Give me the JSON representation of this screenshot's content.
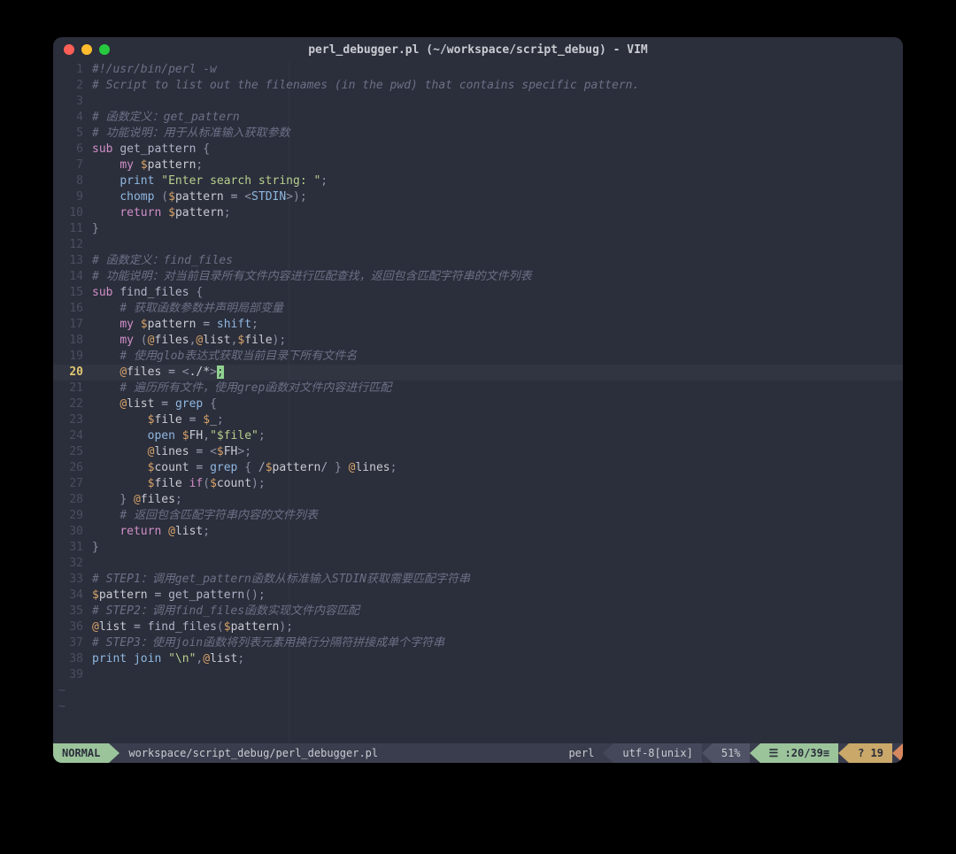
{
  "window": {
    "title": "perl_debugger.pl (~/workspace/script_debug) - VIM"
  },
  "editor": {
    "current_line": 20,
    "lines": [
      {
        "n": 1,
        "tokens": [
          [
            "c-comment",
            "#!/usr/bin/perl -w"
          ]
        ]
      },
      {
        "n": 2,
        "tokens": [
          [
            "c-comment",
            "# Script to list out the filenames (in the pwd) that contains specific pattern."
          ]
        ]
      },
      {
        "n": 3,
        "tokens": []
      },
      {
        "n": 4,
        "tokens": [
          [
            "c-comment",
            "# 函数定义：get_pattern"
          ]
        ]
      },
      {
        "n": 5,
        "tokens": [
          [
            "c-comment",
            "# 功能说明：用于从标准输入获取参数"
          ]
        ]
      },
      {
        "n": 6,
        "tokens": [
          [
            "c-keyword",
            "sub"
          ],
          [
            "",
            " "
          ],
          [
            "c-func",
            "get_pattern"
          ],
          [
            "",
            " "
          ],
          [
            "c-punc",
            "{"
          ]
        ]
      },
      {
        "n": 7,
        "tokens": [
          [
            "",
            "    "
          ],
          [
            "c-keyword",
            "my"
          ],
          [
            "",
            " "
          ],
          [
            "c-sigil",
            "$"
          ],
          [
            "c-var",
            "pattern"
          ],
          [
            "c-punc",
            ";"
          ]
        ]
      },
      {
        "n": 8,
        "tokens": [
          [
            "",
            "    "
          ],
          [
            "c-builtin",
            "print"
          ],
          [
            "",
            " "
          ],
          [
            "c-string",
            "\"Enter search string: \""
          ],
          [
            "c-punc",
            ";"
          ]
        ]
      },
      {
        "n": 9,
        "tokens": [
          [
            "",
            "    "
          ],
          [
            "c-builtin",
            "chomp"
          ],
          [
            "",
            " "
          ],
          [
            "c-punc",
            "("
          ],
          [
            "c-sigil",
            "$"
          ],
          [
            "c-var",
            "pattern"
          ],
          [
            "",
            " "
          ],
          [
            "c-op",
            "="
          ],
          [
            "",
            " "
          ],
          [
            "c-punc",
            "<"
          ],
          [
            "c-builtin",
            "STDIN"
          ],
          [
            "c-punc",
            ">"
          ],
          [
            "c-punc",
            ")"
          ],
          [
            "c-punc",
            ";"
          ]
        ]
      },
      {
        "n": 10,
        "tokens": [
          [
            "",
            "    "
          ],
          [
            "c-keyword",
            "return"
          ],
          [
            "",
            " "
          ],
          [
            "c-sigil",
            "$"
          ],
          [
            "c-var",
            "pattern"
          ],
          [
            "c-punc",
            ";"
          ]
        ]
      },
      {
        "n": 11,
        "tokens": [
          [
            "c-punc",
            "}"
          ]
        ]
      },
      {
        "n": 12,
        "tokens": []
      },
      {
        "n": 13,
        "tokens": [
          [
            "c-comment",
            "# 函数定义：find_files"
          ]
        ]
      },
      {
        "n": 14,
        "tokens": [
          [
            "c-comment",
            "# 功能说明：对当前目录所有文件内容进行匹配查找，返回包含匹配字符串的文件列表"
          ]
        ]
      },
      {
        "n": 15,
        "tokens": [
          [
            "c-keyword",
            "sub"
          ],
          [
            "",
            " "
          ],
          [
            "c-func",
            "find_files"
          ],
          [
            "",
            " "
          ],
          [
            "c-punc",
            "{"
          ]
        ]
      },
      {
        "n": 16,
        "tokens": [
          [
            "",
            "    "
          ],
          [
            "c-comment",
            "# 获取函数参数并声明局部变量"
          ]
        ]
      },
      {
        "n": 17,
        "tokens": [
          [
            "",
            "    "
          ],
          [
            "c-keyword",
            "my"
          ],
          [
            "",
            " "
          ],
          [
            "c-sigil",
            "$"
          ],
          [
            "c-var",
            "pattern"
          ],
          [
            "",
            " "
          ],
          [
            "c-op",
            "="
          ],
          [
            "",
            " "
          ],
          [
            "c-builtin",
            "shift"
          ],
          [
            "c-punc",
            ";"
          ]
        ]
      },
      {
        "n": 18,
        "tokens": [
          [
            "",
            "    "
          ],
          [
            "c-keyword",
            "my"
          ],
          [
            "",
            " "
          ],
          [
            "c-punc",
            "("
          ],
          [
            "c-sigil",
            "@"
          ],
          [
            "c-var",
            "files"
          ],
          [
            "c-punc",
            ","
          ],
          [
            "c-sigil",
            "@"
          ],
          [
            "c-var",
            "list"
          ],
          [
            "c-punc",
            ","
          ],
          [
            "c-sigil",
            "$"
          ],
          [
            "c-var",
            "file"
          ],
          [
            "c-punc",
            ")"
          ],
          [
            "c-punc",
            ";"
          ]
        ]
      },
      {
        "n": 19,
        "tokens": [
          [
            "",
            "    "
          ],
          [
            "c-comment",
            "# 使用glob表达式获取当前目录下所有文件名"
          ]
        ]
      },
      {
        "n": 20,
        "tokens": [
          [
            "",
            "    "
          ],
          [
            "c-sigil",
            "@"
          ],
          [
            "c-var",
            "files"
          ],
          [
            "",
            " "
          ],
          [
            "c-op",
            "="
          ],
          [
            "",
            " "
          ],
          [
            "c-punc",
            "<"
          ],
          [
            "c-var",
            "./*"
          ],
          [
            "c-punc",
            ">"
          ],
          [
            "cursor",
            ";"
          ]
        ]
      },
      {
        "n": 21,
        "tokens": [
          [
            "",
            "    "
          ],
          [
            "c-comment",
            "# 遍历所有文件，使用grep函数对文件内容进行匹配"
          ]
        ]
      },
      {
        "n": 22,
        "tokens": [
          [
            "",
            "    "
          ],
          [
            "c-sigil",
            "@"
          ],
          [
            "c-var",
            "list"
          ],
          [
            "",
            " "
          ],
          [
            "c-op",
            "="
          ],
          [
            "",
            " "
          ],
          [
            "c-builtin",
            "grep"
          ],
          [
            "",
            " "
          ],
          [
            "c-punc",
            "{"
          ]
        ]
      },
      {
        "n": 23,
        "tokens": [
          [
            "",
            "        "
          ],
          [
            "c-sigil",
            "$"
          ],
          [
            "c-var",
            "file"
          ],
          [
            "",
            " "
          ],
          [
            "c-op",
            "="
          ],
          [
            "",
            " "
          ],
          [
            "c-sigil",
            "$"
          ],
          [
            "c-var",
            "_"
          ],
          [
            "c-punc",
            ";"
          ]
        ]
      },
      {
        "n": 24,
        "tokens": [
          [
            "",
            "        "
          ],
          [
            "c-builtin",
            "open"
          ],
          [
            "",
            " "
          ],
          [
            "c-sigil",
            "$"
          ],
          [
            "c-var",
            "FH"
          ],
          [
            "c-punc",
            ","
          ],
          [
            "c-string",
            "\"$file\""
          ],
          [
            "c-punc",
            ";"
          ]
        ]
      },
      {
        "n": 25,
        "tokens": [
          [
            "",
            "        "
          ],
          [
            "c-sigil",
            "@"
          ],
          [
            "c-var",
            "lines"
          ],
          [
            "",
            " "
          ],
          [
            "c-op",
            "="
          ],
          [
            "",
            " "
          ],
          [
            "c-punc",
            "<"
          ],
          [
            "c-sigil",
            "$"
          ],
          [
            "c-var",
            "FH"
          ],
          [
            "c-punc",
            ">"
          ],
          [
            "c-punc",
            ";"
          ]
        ]
      },
      {
        "n": 26,
        "tokens": [
          [
            "",
            "        "
          ],
          [
            "c-sigil",
            "$"
          ],
          [
            "c-var",
            "count"
          ],
          [
            "",
            " "
          ],
          [
            "c-op",
            "="
          ],
          [
            "",
            " "
          ],
          [
            "c-builtin",
            "grep"
          ],
          [
            "",
            " "
          ],
          [
            "c-punc",
            "{"
          ],
          [
            "",
            " "
          ],
          [
            "c-op",
            "/"
          ],
          [
            "c-sigil",
            "$"
          ],
          [
            "c-var",
            "pattern"
          ],
          [
            "c-op",
            "/"
          ],
          [
            "",
            " "
          ],
          [
            "c-punc",
            "}"
          ],
          [
            "",
            " "
          ],
          [
            "c-sigil",
            "@"
          ],
          [
            "c-var",
            "lines"
          ],
          [
            "c-punc",
            ";"
          ]
        ]
      },
      {
        "n": 27,
        "tokens": [
          [
            "",
            "        "
          ],
          [
            "c-sigil",
            "$"
          ],
          [
            "c-var",
            "file"
          ],
          [
            "",
            " "
          ],
          [
            "c-keyword",
            "if"
          ],
          [
            "c-punc",
            "("
          ],
          [
            "c-sigil",
            "$"
          ],
          [
            "c-var",
            "count"
          ],
          [
            "c-punc",
            ")"
          ],
          [
            "c-punc",
            ";"
          ]
        ]
      },
      {
        "n": 28,
        "tokens": [
          [
            "",
            "    "
          ],
          [
            "c-punc",
            "}"
          ],
          [
            "",
            " "
          ],
          [
            "c-sigil",
            "@"
          ],
          [
            "c-var",
            "files"
          ],
          [
            "c-punc",
            ";"
          ]
        ]
      },
      {
        "n": 29,
        "tokens": [
          [
            "",
            "    "
          ],
          [
            "c-comment",
            "# 返回包含匹配字符串内容的文件列表"
          ]
        ]
      },
      {
        "n": 30,
        "tokens": [
          [
            "",
            "    "
          ],
          [
            "c-keyword",
            "return"
          ],
          [
            "",
            " "
          ],
          [
            "c-sigil",
            "@"
          ],
          [
            "c-var",
            "list"
          ],
          [
            "c-punc",
            ";"
          ]
        ]
      },
      {
        "n": 31,
        "tokens": [
          [
            "c-punc",
            "}"
          ]
        ]
      },
      {
        "n": 32,
        "tokens": []
      },
      {
        "n": 33,
        "tokens": [
          [
            "c-comment",
            "# STEP1：调用get_pattern函数从标准输入STDIN获取需要匹配字符串"
          ]
        ]
      },
      {
        "n": 34,
        "tokens": [
          [
            "c-sigil",
            "$"
          ],
          [
            "c-var",
            "pattern"
          ],
          [
            "",
            " "
          ],
          [
            "c-op",
            "="
          ],
          [
            "",
            " "
          ],
          [
            "c-func",
            "get_pattern"
          ],
          [
            "c-punc",
            "()"
          ],
          [
            "c-punc",
            ";"
          ]
        ]
      },
      {
        "n": 35,
        "tokens": [
          [
            "c-comment",
            "# STEP2：调用find_files函数实现文件内容匹配"
          ]
        ]
      },
      {
        "n": 36,
        "tokens": [
          [
            "c-sigil",
            "@"
          ],
          [
            "c-var",
            "list"
          ],
          [
            "",
            " "
          ],
          [
            "c-op",
            "="
          ],
          [
            "",
            " "
          ],
          [
            "c-func",
            "find_files"
          ],
          [
            "c-punc",
            "("
          ],
          [
            "c-sigil",
            "$"
          ],
          [
            "c-var",
            "pattern"
          ],
          [
            "c-punc",
            ")"
          ],
          [
            "c-punc",
            ";"
          ]
        ]
      },
      {
        "n": 37,
        "tokens": [
          [
            "c-comment",
            "# STEP3：使用join函数将列表元素用换行分隔符拼接成单个字符串"
          ]
        ]
      },
      {
        "n": 38,
        "tokens": [
          [
            "c-builtin",
            "print"
          ],
          [
            "",
            " "
          ],
          [
            "c-builtin",
            "join"
          ],
          [
            "",
            " "
          ],
          [
            "c-string",
            "\"\\n\""
          ],
          [
            "c-punc",
            ","
          ],
          [
            "c-sigil",
            "@"
          ],
          [
            "c-var",
            "list"
          ],
          [
            "c-punc",
            ";"
          ]
        ]
      },
      {
        "n": 39,
        "tokens": []
      }
    ],
    "tilde_rows": 2
  },
  "status": {
    "mode": "NORMAL",
    "path": "workspace/script_debug/perl_debugger.pl",
    "filetype": "perl",
    "encoding": "utf-8[unix]",
    "percent": "51%",
    "position": "☰ :20/39≡",
    "warnings": "? 19"
  }
}
